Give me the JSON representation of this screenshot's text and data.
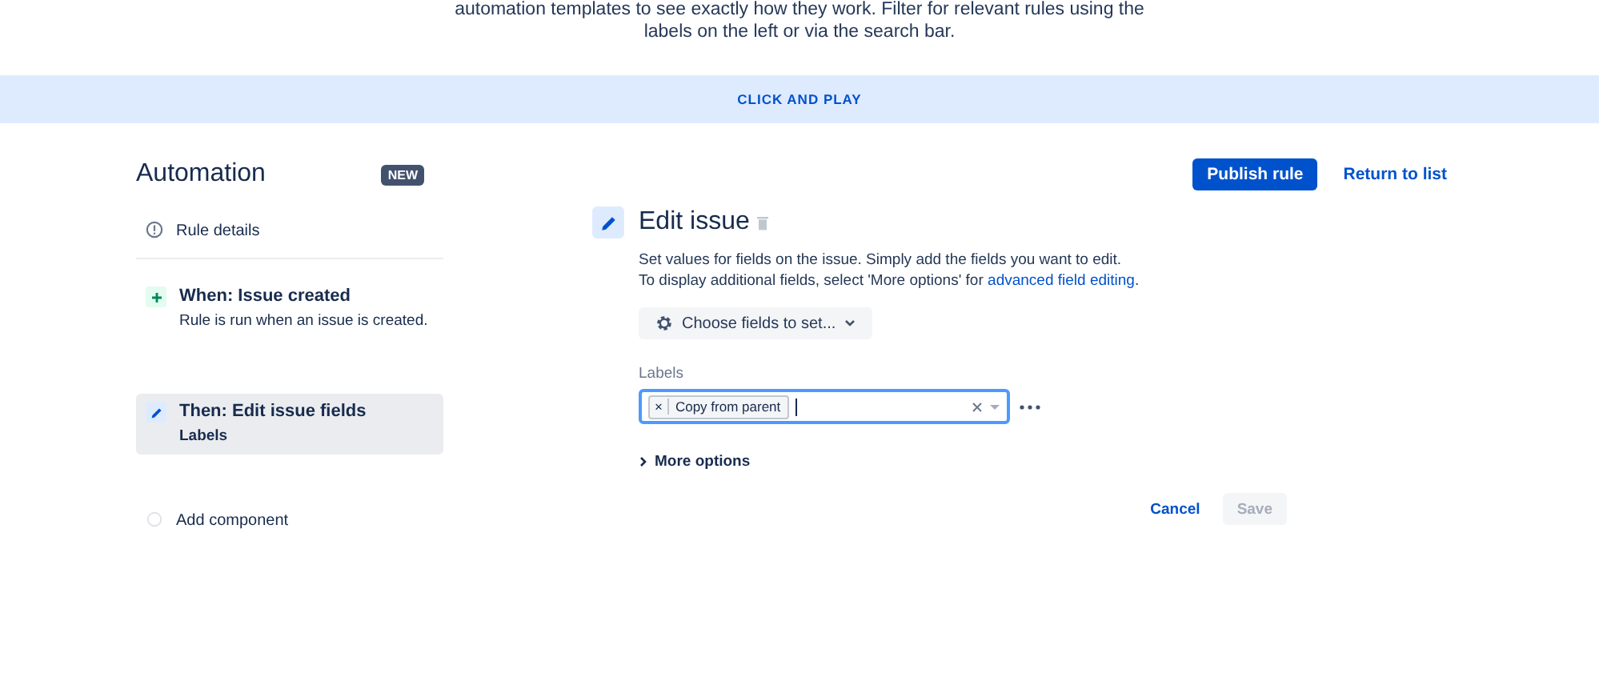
{
  "intro": {
    "lines": [
      "automation templates to see exactly how they work. Filter for relevant rules using the",
      "labels on the left or via the search bar."
    ]
  },
  "banner": {
    "label": "CLICK AND PLAY"
  },
  "sidebar": {
    "title": "Automation",
    "badge": "NEW",
    "items": [
      {
        "kind": "details",
        "title": "Rule details",
        "selected": false
      },
      {
        "kind": "trigger",
        "title": "When: Issue created",
        "subtitle": "Rule is run when an issue is created.",
        "selected": false
      },
      {
        "kind": "action",
        "title": "Then: Edit issue fields",
        "subtitle": "Labels",
        "selected": true
      },
      {
        "kind": "add",
        "title": "Add component",
        "selected": false
      }
    ]
  },
  "header_actions": {
    "publish": "Publish rule",
    "return": "Return to list"
  },
  "editor": {
    "title": "Edit issue",
    "description_line_1": "Set values for fields on the issue. Simply add the fields you want to edit.",
    "description_line_2": "To display additional fields, select 'More options' for",
    "link": "advanced field editing",
    "link_suffix": ".",
    "choose_button": "Choose fields to set...",
    "field_label": "Labels",
    "chips": [
      {
        "remove": "×",
        "label": "Copy from parent"
      }
    ],
    "more_options": "More options",
    "cancel": "Cancel",
    "save": {
      "label": "Save",
      "disabled": true
    }
  }
}
